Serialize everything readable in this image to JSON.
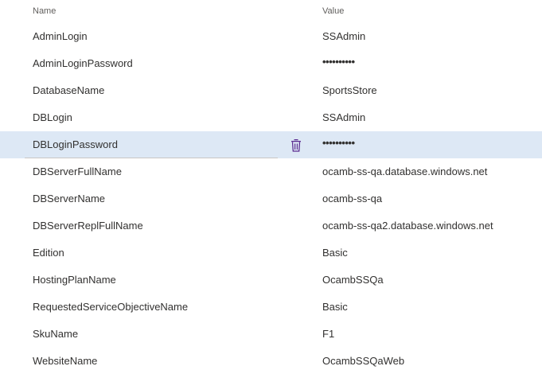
{
  "header": {
    "name_label": "Name",
    "value_label": "Value"
  },
  "rows": [
    {
      "name": "AdminLogin",
      "value": "SSAdmin"
    },
    {
      "name": "AdminLoginPassword",
      "value": "••••••••••"
    },
    {
      "name": "DatabaseName",
      "value": "SportsStore"
    },
    {
      "name": "DBLogin",
      "value": "SSAdmin"
    },
    {
      "name": "DBLoginPassword",
      "value": "••••••••••"
    },
    {
      "name": "DBServerFullName",
      "value": "ocamb-ss-qa.database.windows.net"
    },
    {
      "name": "DBServerName",
      "value": "ocamb-ss-qa"
    },
    {
      "name": "DBServerReplFullName",
      "value": "ocamb-ss-qa2.database.windows.net"
    },
    {
      "name": "Edition",
      "value": "Basic"
    },
    {
      "name": "HostingPlanName",
      "value": "OcambSSQa"
    },
    {
      "name": "RequestedServiceObjectiveName",
      "value": "Basic"
    },
    {
      "name": "SkuName",
      "value": "F1"
    },
    {
      "name": "WebsiteName",
      "value": "OcambSSQaWeb"
    }
  ],
  "selected_row": "DBLoginPassword",
  "colors": {
    "selected_background": "#dde8f5",
    "delete_icon": "#5c2d91"
  },
  "icons": {
    "delete": "trash-icon"
  }
}
